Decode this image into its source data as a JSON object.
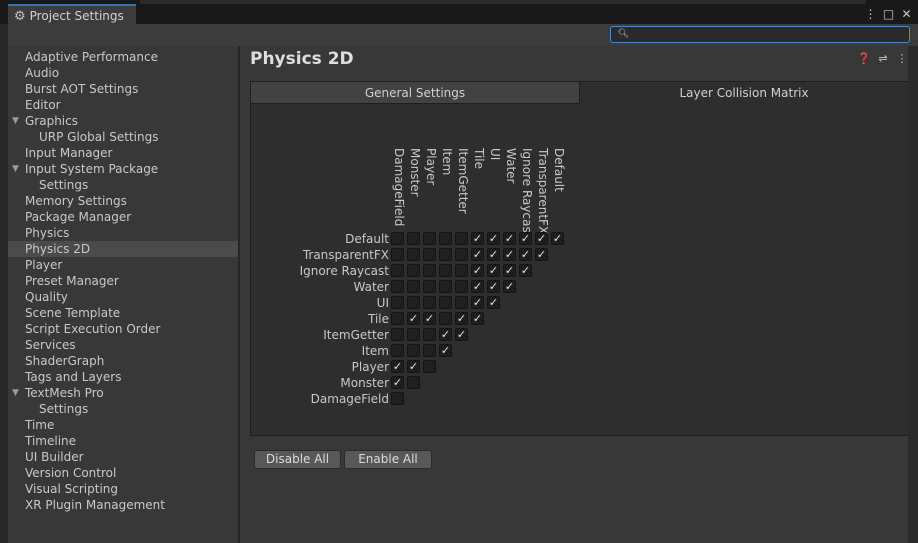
{
  "window": {
    "tab_title": "Project Settings",
    "icons": [
      "more-icon",
      "maximize-icon",
      "close-icon"
    ]
  },
  "search": {
    "value": "",
    "placeholder": ""
  },
  "sidebar": {
    "items": [
      {
        "label": "Adaptive Performance"
      },
      {
        "label": "Audio"
      },
      {
        "label": "Burst AOT Settings"
      },
      {
        "label": "Editor"
      },
      {
        "label": "Graphics",
        "foldout": true
      },
      {
        "label": "URP Global Settings",
        "sub": true
      },
      {
        "label": "Input Manager"
      },
      {
        "label": "Input System Package",
        "foldout": true
      },
      {
        "label": "Settings",
        "sub": true
      },
      {
        "label": "Memory Settings"
      },
      {
        "label": "Package Manager"
      },
      {
        "label": "Physics"
      },
      {
        "label": "Physics 2D",
        "selected": true
      },
      {
        "label": "Player"
      },
      {
        "label": "Preset Manager"
      },
      {
        "label": "Quality"
      },
      {
        "label": "Scene Template"
      },
      {
        "label": "Script Execution Order"
      },
      {
        "label": "Services"
      },
      {
        "label": "ShaderGraph"
      },
      {
        "label": "Tags and Layers"
      },
      {
        "label": "TextMesh Pro",
        "foldout": true
      },
      {
        "label": "Settings",
        "sub": true
      },
      {
        "label": "Time"
      },
      {
        "label": "Timeline"
      },
      {
        "label": "UI Builder"
      },
      {
        "label": "Version Control"
      },
      {
        "label": "Visual Scripting"
      },
      {
        "label": "XR Plugin Management"
      }
    ]
  },
  "main": {
    "title": "Physics 2D",
    "header_icons": [
      "help-icon",
      "preset-icon",
      "more-icon"
    ],
    "tabs": [
      {
        "label": "General Settings",
        "active": false
      },
      {
        "label": "Layer Collision Matrix",
        "active": true
      }
    ],
    "matrix": {
      "columns": [
        "DamageField",
        "Monster",
        "Player",
        "Item",
        "ItemGetter",
        "Tile",
        "UI",
        "Water",
        "Ignore Raycast",
        "TransparentFX",
        "Default"
      ],
      "rows": [
        {
          "label": "Default",
          "checks": [
            false,
            false,
            false,
            false,
            false,
            true,
            true,
            true,
            true,
            true,
            true
          ]
        },
        {
          "label": "TransparentFX",
          "checks": [
            false,
            false,
            false,
            false,
            false,
            true,
            true,
            true,
            true,
            true
          ]
        },
        {
          "label": "Ignore Raycast",
          "checks": [
            false,
            false,
            false,
            false,
            false,
            true,
            true,
            true,
            true
          ]
        },
        {
          "label": "Water",
          "checks": [
            false,
            false,
            false,
            false,
            false,
            true,
            true,
            true
          ]
        },
        {
          "label": "UI",
          "checks": [
            false,
            false,
            false,
            false,
            false,
            true,
            true
          ]
        },
        {
          "label": "Tile",
          "checks": [
            false,
            true,
            true,
            false,
            true,
            true
          ]
        },
        {
          "label": "ItemGetter",
          "checks": [
            false,
            false,
            false,
            true,
            true
          ]
        },
        {
          "label": "Item",
          "checks": [
            false,
            false,
            false,
            true
          ]
        },
        {
          "label": "Player",
          "checks": [
            true,
            true,
            false
          ]
        },
        {
          "label": "Monster",
          "checks": [
            true,
            false
          ]
        },
        {
          "label": "DamageField",
          "checks": [
            false
          ]
        }
      ]
    },
    "buttons": {
      "disable_all": "Disable All",
      "enable_all": "Enable All"
    }
  }
}
